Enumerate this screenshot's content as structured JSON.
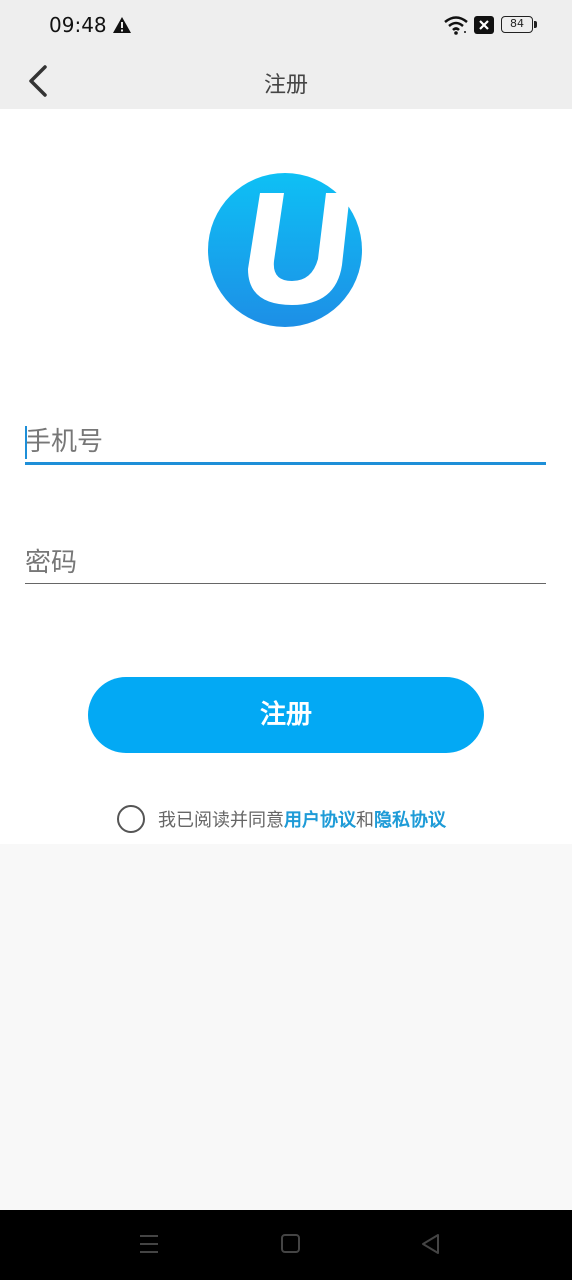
{
  "status_bar": {
    "time": "09:48",
    "battery": "84",
    "icons": [
      "warning-icon",
      "wifi-icon",
      "close-box-icon",
      "battery-icon"
    ]
  },
  "header": {
    "title": "注册",
    "back_icon": "chevron-left-icon"
  },
  "logo": {
    "letter": "U",
    "colors": [
      "#0ec0f5",
      "#1d8fe6"
    ]
  },
  "form": {
    "phone_placeholder": "手机号",
    "phone_value": "",
    "password_placeholder": "密码",
    "password_value": ""
  },
  "register_button": {
    "label": "注册"
  },
  "agreement": {
    "prefix": "我已阅读并同意",
    "user_agreement": "用户协议",
    "conjunction": "和",
    "privacy_policy": "隐私协议",
    "checked": false
  },
  "nav_bar": {
    "icons": [
      "menu-icon",
      "home-square-icon",
      "back-triangle-icon"
    ]
  },
  "colors": {
    "accent": "#03a9f4",
    "link": "#1e9bd7",
    "input_active": "#1e8fd8",
    "header_bg": "#eeeeee"
  }
}
